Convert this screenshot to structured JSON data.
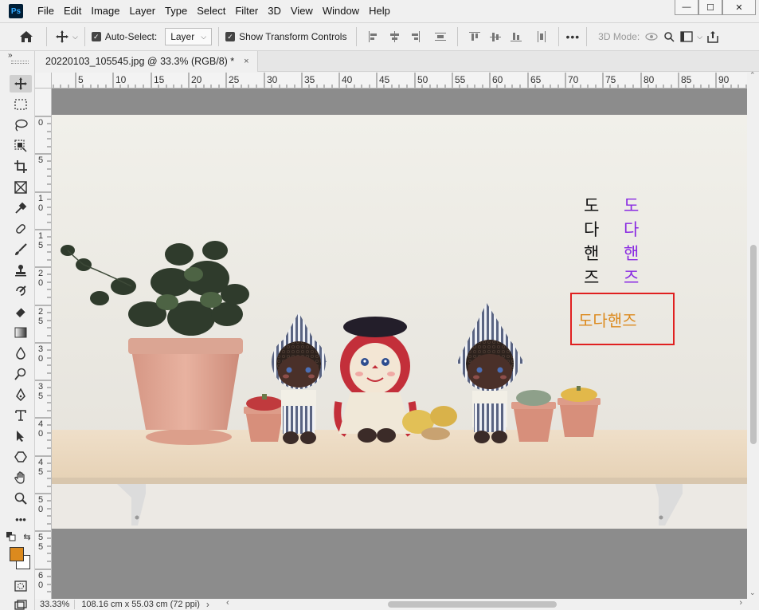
{
  "app": {
    "logo": "Ps"
  },
  "menu": [
    "File",
    "Edit",
    "Image",
    "Layer",
    "Type",
    "Select",
    "Filter",
    "3D",
    "View",
    "Window",
    "Help"
  ],
  "window_controls": {
    "minimize": "—",
    "maximize": "☐",
    "close": "✕"
  },
  "options": {
    "auto_select_label": "Auto-Select:",
    "auto_select_checked": true,
    "auto_select_target": "Layer",
    "show_transform_label": "Show Transform Controls",
    "show_transform_checked": true,
    "more": "•••",
    "mode_3d_label": "3D Mode:"
  },
  "document_tab": {
    "title": "20220103_105545.jpg @ 33.3% (RGB/8) *",
    "close": "×"
  },
  "rulers": {
    "horizontal": [
      "5",
      "10",
      "15",
      "20",
      "25",
      "30",
      "35",
      "40",
      "45",
      "50",
      "55",
      "60",
      "65",
      "70",
      "75",
      "80",
      "85",
      "90"
    ],
    "vertical": [
      "0",
      "5",
      "1\n0",
      "1\n5",
      "2\n0",
      "2\n5",
      "3\n0",
      "3\n5",
      "4\n0",
      "4\n5",
      "5\n0",
      "5\n5",
      "6\n0"
    ]
  },
  "canvas": {
    "text_black": [
      "도",
      "다",
      "핸",
      "즈"
    ],
    "text_purple": [
      "도",
      "다",
      "핸",
      "즈"
    ],
    "text_orange": "도다핸즈"
  },
  "colors": {
    "foreground": "#dc8a1e",
    "background": "#ffffff",
    "text_black": "#111111",
    "text_purple": "#8a2be2",
    "text_orange": "#dc8a1e",
    "selection_box": "#e02020"
  },
  "status": {
    "zoom": "33.33%",
    "doc_size": "108.16 cm x 55.03 cm (72 ppi)",
    "arrow": "›"
  },
  "tools": [
    "move-icon",
    "marquee-icon",
    "lasso-icon",
    "object-select-icon",
    "crop-icon",
    "frame-icon",
    "eyedropper-icon",
    "healing-icon",
    "brush-icon",
    "stamp-icon",
    "history-brush-icon",
    "eraser-icon",
    "gradient-icon",
    "blur-icon",
    "dodge-icon",
    "pen-icon",
    "type-icon",
    "path-select-icon",
    "shape-icon",
    "hand-icon",
    "zoom-icon",
    "more-tools-icon"
  ]
}
